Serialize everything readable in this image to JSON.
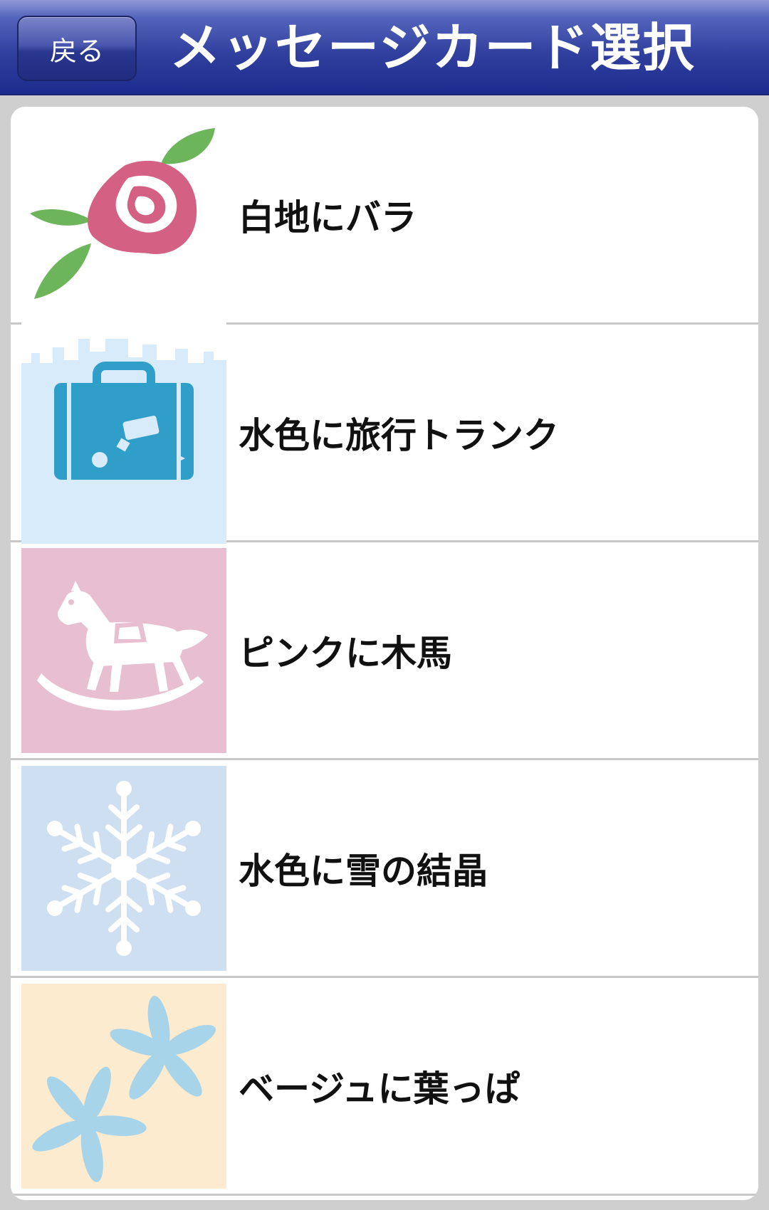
{
  "header": {
    "back_label": "戻る",
    "title": "メッセージカード選択"
  },
  "cards": [
    {
      "label": "白地にバラ",
      "icon": "rose-icon",
      "bg": "#ffffff"
    },
    {
      "label": "水色に旅行トランク",
      "icon": "suitcase-icon",
      "bg": "#d7ebfa"
    },
    {
      "label": "ピンクに木馬",
      "icon": "rocking-horse-icon",
      "bg": "#e8bfd0"
    },
    {
      "label": "水色に雪の結晶",
      "icon": "snowflake-icon",
      "bg": "#cddff0"
    },
    {
      "label": "ベージュに葉っぱ",
      "icon": "leaves-icon",
      "bg": "#fdebcf"
    }
  ],
  "colors": {
    "header_dark": "#1d2b8e",
    "header_light": "#8f98d6",
    "rose": "#d46083",
    "leaf_green": "#6db55a",
    "suitcase_blue": "#2f9fc9",
    "leaf_blue": "#a8d4ea"
  }
}
